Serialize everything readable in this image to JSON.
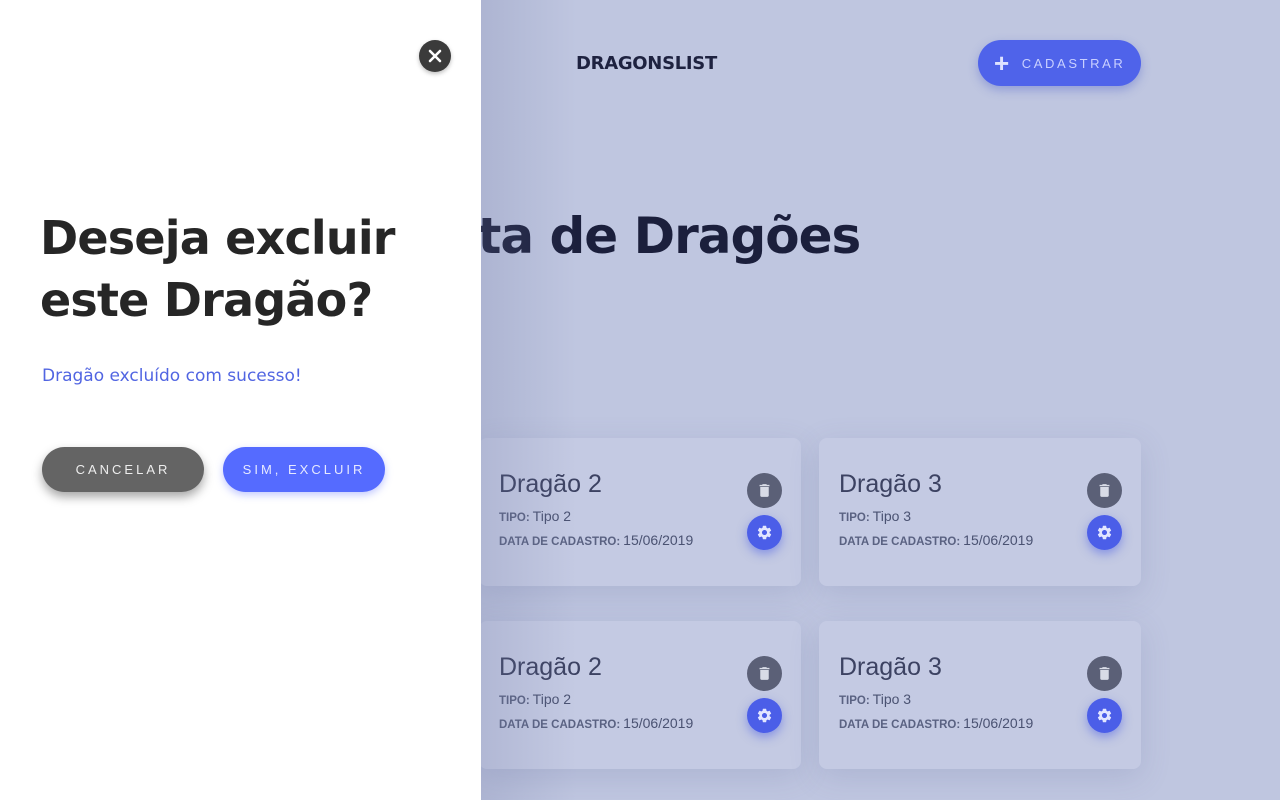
{
  "header": {
    "brand": "DRAGONSLIST",
    "register_label": "CADASTRAR",
    "register_icon": "plus-icon"
  },
  "main": {
    "headline": " lista de Dragões\nl."
  },
  "cards": [
    {
      "title": "Dragão 2",
      "type_key": "TIPO:",
      "type_value": "Tipo 2",
      "date_key": "DATA DE CADASTRO:",
      "date_value": "15/06/2019"
    },
    {
      "title": "Dragão 3",
      "type_key": "TIPO:",
      "type_value": "Tipo 3",
      "date_key": "DATA DE CADASTRO:",
      "date_value": "15/06/2019"
    },
    {
      "title": "Dragão 2",
      "type_key": "TIPO:",
      "type_value": "Tipo 2",
      "date_key": "DATA DE CADASTRO:",
      "date_value": "15/06/2019"
    },
    {
      "title": "Dragão 3",
      "type_key": "TIPO:",
      "type_value": "Tipo 3",
      "date_key": "DATA DE CADASTRO:",
      "date_value": "15/06/2019"
    }
  ],
  "card_icons": {
    "delete": "trash-icon",
    "edit": "gear-icon"
  },
  "modal": {
    "title": "Deseja excluir este Dragão?",
    "message": "Dragão excluído com sucesso!",
    "cancel_label": "CANCELAR",
    "confirm_label": "SIM, EXCLUIR",
    "close_icon": "close-icon"
  },
  "colors": {
    "accent": "#4f63ea",
    "modal_bg": "#ffffff",
    "overlay_bg": "#bfc6e0",
    "cancel_bg": "#646464",
    "message_text": "#5165e2"
  }
}
